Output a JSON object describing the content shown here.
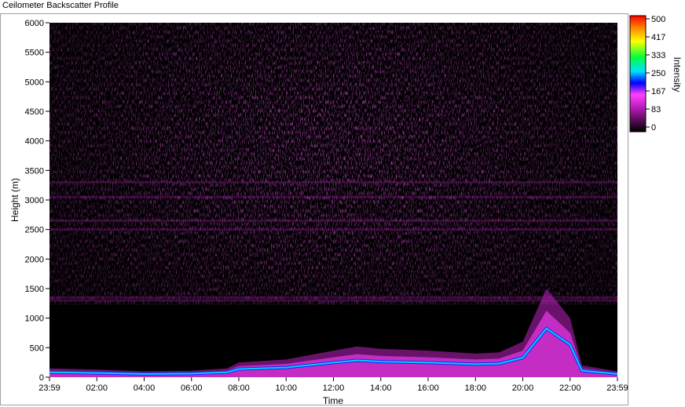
{
  "window": {
    "title": "Ceilometer Backscatter Profile"
  },
  "chart_data": {
    "type": "heatmap",
    "title": "",
    "xlabel": "Time",
    "ylabel": "Height (m)",
    "x_ticks": [
      "23:59",
      "02:00",
      "04:00",
      "06:00",
      "08:00",
      "10:00",
      "12:00",
      "14:00",
      "16:00",
      "18:00",
      "20:00",
      "22:00",
      "23:59"
    ],
    "y_ticks": [
      0,
      500,
      1000,
      1500,
      2000,
      2500,
      3000,
      3500,
      4000,
      4500,
      5000,
      5500,
      6000
    ],
    "ylim": [
      0,
      6000
    ],
    "colorbar": {
      "label": "Intensity",
      "ticks": [
        "500",
        "417",
        "333",
        "250",
        "167",
        "83",
        "0"
      ],
      "range": [
        0,
        500
      ],
      "colors": [
        "#000000",
        "#5a0a5a",
        "#c020c0",
        "#ff40ff",
        "#0000ff",
        "#00e0ff",
        "#00ff40",
        "#ffff00",
        "#ff8000",
        "#ff0000"
      ]
    },
    "boundary_layer": {
      "hours": [
        0,
        2,
        4,
        6,
        7.5,
        8,
        10,
        12,
        13,
        14,
        16,
        18,
        19,
        20,
        21,
        22,
        22.5,
        24
      ],
      "height_m": [
        150,
        130,
        100,
        110,
        150,
        250,
        300,
        450,
        520,
        480,
        450,
        400,
        420,
        600,
        1500,
        1000,
        200,
        100
      ]
    },
    "grid": false
  }
}
